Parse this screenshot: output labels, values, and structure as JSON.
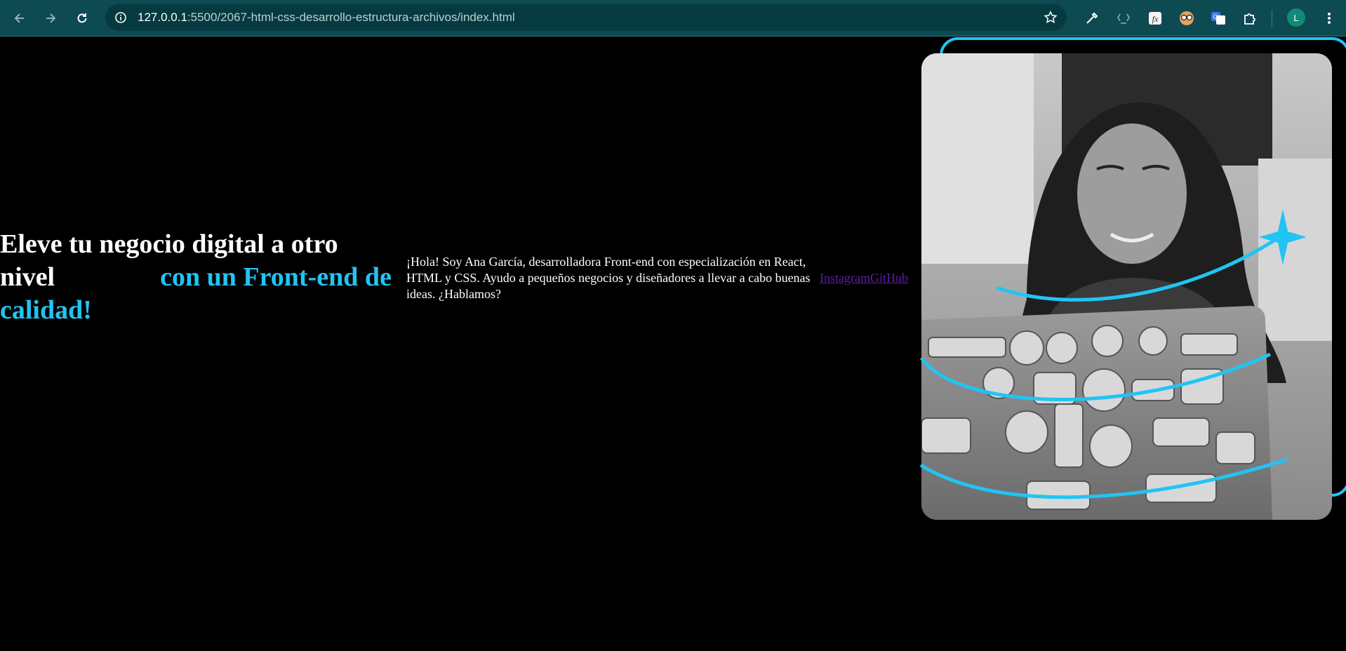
{
  "browser": {
    "url_host": "127.0.0.1",
    "url_path": ":5500/2067-html-css-desarrollo-estructura-archivos/index.html",
    "profile_initial": "L",
    "icons": [
      "back-arrow-icon",
      "forward-arrow-icon",
      "reload-icon",
      "site-info-icon",
      "bookmark-star-icon",
      "eyedropper-icon",
      "recycle-icon",
      "function-icon",
      "glasses-icon",
      "translate-icon",
      "extensions-puzzle-icon",
      "more-vert-icon"
    ]
  },
  "hero": {
    "title_part1": "Eleve tu negocio digital a otro nivel",
    "title_accent": "con un Front-end de calidad!",
    "intro": "¡Hola! Soy Ana García, desarrolladora Front-end con especialización en React, HTML y CSS. Ayudo a pequeños negocios y diseñadores a llevar a cabo buenas ideas. ¿Hablamos?",
    "links": {
      "instagram": "Instagram",
      "github": "GitHub"
    }
  },
  "colors": {
    "accent": "#21c4f3",
    "chrome_bg": "#0d4a52",
    "link_visited": "#5b1ea8"
  }
}
